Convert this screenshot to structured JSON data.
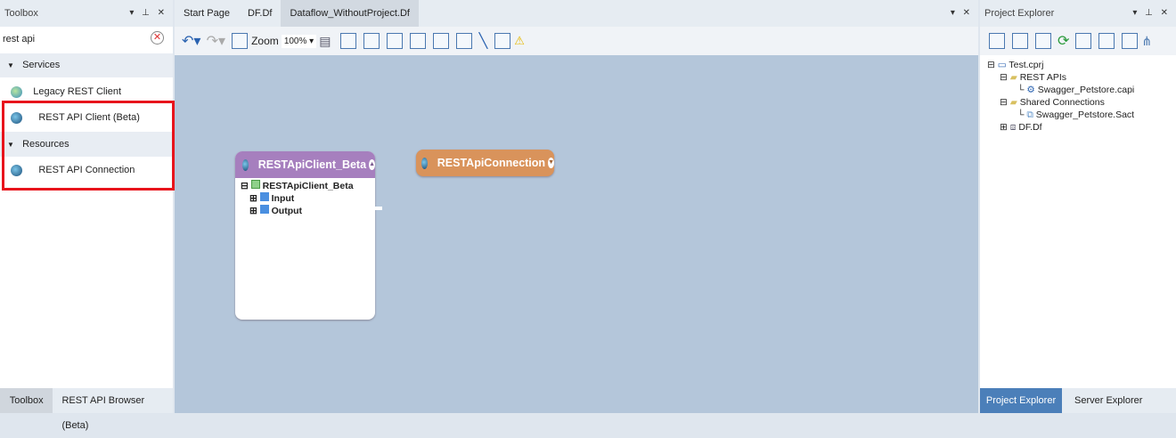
{
  "toolbox": {
    "title": "Toolbox",
    "search_value": "rest api",
    "groups": [
      {
        "label": "Services",
        "items": [
          "Legacy REST Client",
          "REST API Client (Beta)"
        ]
      },
      {
        "label": "Resources",
        "items": [
          "REST API Connection"
        ]
      }
    ],
    "bottom_tabs": [
      "Toolbox",
      "REST API Browser (Beta)"
    ]
  },
  "editor": {
    "tabs": [
      "Start Page",
      "DF.Df",
      "Dataflow_WithoutProject.Df"
    ],
    "active_tab": 2,
    "toolbar": {
      "zoom_label": "Zoom",
      "zoom_value": "100%"
    },
    "nodes": {
      "client": {
        "title": "RESTApiClient_Beta",
        "root": "RESTApiClient_Beta",
        "children": [
          "Input",
          "Output"
        ],
        "color": "#a67fbe"
      },
      "connection": {
        "title": "RESTApiConnection",
        "color": "#d9935b"
      }
    }
  },
  "project_explorer": {
    "title": "Project Explorer",
    "tree": {
      "root": "Test.cprj",
      "folders": [
        {
          "label": "REST APIs",
          "items": [
            "Swagger_Petstore.capi"
          ]
        },
        {
          "label": "Shared Connections",
          "items": [
            "Swagger_Petstore.Sact"
          ]
        }
      ],
      "df": "DF.Df"
    },
    "bottom_tabs": [
      "Project Explorer",
      "Server Explorer"
    ],
    "active_tab": 0
  },
  "highlight_color": "#e8141c"
}
